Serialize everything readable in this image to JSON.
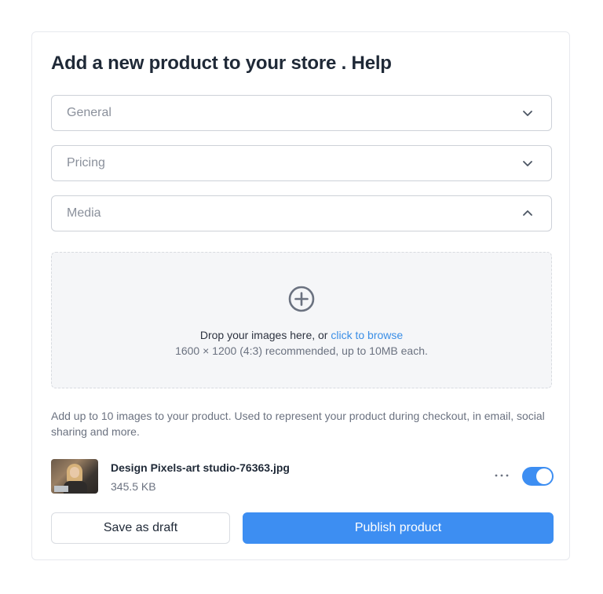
{
  "page": {
    "title": "Add a new product to your store . Help"
  },
  "accordions": [
    {
      "label": "General",
      "expanded": false,
      "icon": "chevron-down-icon"
    },
    {
      "label": "Pricing",
      "expanded": false,
      "icon": "chevron-down-icon"
    },
    {
      "label": "Media",
      "expanded": true,
      "icon": "chevron-up-icon"
    }
  ],
  "dropzone": {
    "icon": "plus-circle-icon",
    "prompt": "Drop your images here, or",
    "link_text": "click to browse",
    "hint": "1600 × 1200 (4:3) recommended, up to 10MB each."
  },
  "helper_text": "Add up to 10 images to your product. Used to represent your product during checkout, in email, social sharing and more.",
  "file": {
    "name": "Design Pixels-art studio-76363.jpg",
    "size": "345.5 KB",
    "more_icon": "more-horizontal-icon",
    "toggle_on": true
  },
  "actions": {
    "draft_label": "Save as draft",
    "publish_label": "Publish product"
  },
  "colors": {
    "accent": "#3d8ef2",
    "link": "#3a8ee6",
    "border": "#cdd1d8",
    "dropzone_bg": "#f5f6f8"
  }
}
